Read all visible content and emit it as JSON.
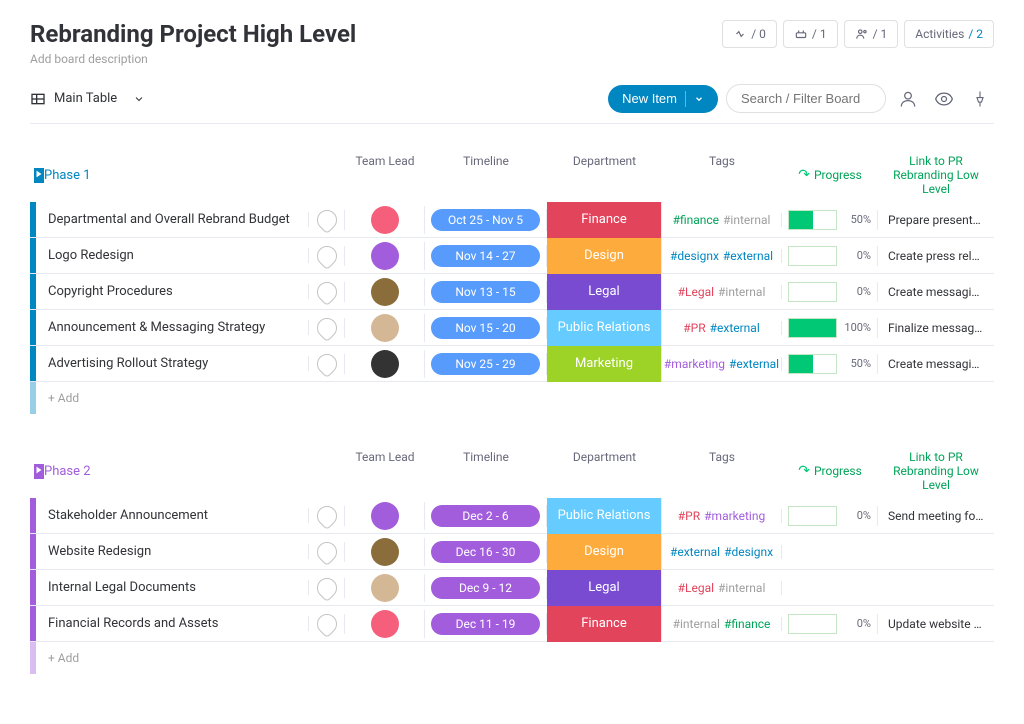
{
  "header": {
    "title": "Rebranding Project High Level",
    "description": "Add board description",
    "badge_sync": "/ 0",
    "badge_integ": "/ 1",
    "badge_people": "/ 1",
    "badge_activities_label": "Activities",
    "badge_activities_count": "/ 2"
  },
  "toolbar": {
    "view_label": "Main Table",
    "new_item_label": "New Item",
    "search_placeholder": "Search / Filter Board"
  },
  "columns": {
    "team_lead": "Team Lead",
    "timeline": "Timeline",
    "department": "Department",
    "tags": "Tags",
    "progress": "Progress",
    "link": "Link to PR Rebranding Low Level"
  },
  "add_label": "+ Add",
  "groups": [
    {
      "name": "Phase 1",
      "color": "#0086c0",
      "rows": [
        {
          "name": "Departmental and Overall Rebrand Budget",
          "avatar_color": "#f65f7c",
          "timeline": "Oct 25 - Nov 5",
          "timeline_bg": "#579bfc",
          "department": "Finance",
          "dept_bg": "#e2445c",
          "tags": [
            {
              "t": "#finance",
              "c": "#00a359"
            },
            {
              "t": "#internal",
              "c": "#9e9e9e"
            }
          ],
          "progress": 50,
          "link": "Prepare presentation for board memb..."
        },
        {
          "name": "Logo Redesign",
          "avatar_color": "#a25ddc",
          "timeline": "Nov 14 - 27",
          "timeline_bg": "#579bfc",
          "department": "Design",
          "dept_bg": "#fdab3d",
          "tags": [
            {
              "t": "#designx",
              "c": "#0086c0"
            },
            {
              "t": "#external",
              "c": "#0086c0"
            }
          ],
          "progress": 0,
          "link": "Create press release"
        },
        {
          "name": "Copyright Procedures",
          "avatar_color": "#8a6d3b",
          "timeline": "Nov 13 - 15",
          "timeline_bg": "#579bfc",
          "department": "Legal",
          "dept_bg": "#784bd1",
          "tags": [
            {
              "t": "#Legal",
              "c": "#e2445c"
            },
            {
              "t": "#internal",
              "c": "#9e9e9e"
            }
          ],
          "progress": 0,
          "link": "Create messaging copy for social plat..."
        },
        {
          "name": "Announcement & Messaging Strategy",
          "avatar_color": "#d4b896",
          "timeline": "Nov 15 - 20",
          "timeline_bg": "#579bfc",
          "department": "Public Relations",
          "dept_bg": "#66ccff",
          "tags": [
            {
              "t": "#PR",
              "c": "#e2445c"
            },
            {
              "t": "#external",
              "c": "#0086c0"
            }
          ],
          "progress": 100,
          "link": "Finalize message rollout strategy"
        },
        {
          "name": "Advertising Rollout Strategy",
          "avatar_color": "#333333",
          "timeline": "Nov 25 - 29",
          "timeline_bg": "#579bfc",
          "department": "Marketing",
          "dept_bg": "#9cd326",
          "tags": [
            {
              "t": "#marketing",
              "c": "#a25ddc"
            },
            {
              "t": "#external",
              "c": "#0086c0"
            }
          ],
          "progress": 50,
          "link": "Create messaging copy for website la..."
        }
      ]
    },
    {
      "name": "Phase 2",
      "color": "#a25ddc",
      "rows": [
        {
          "name": "Stakeholder Announcement",
          "avatar_color": "#a25ddc",
          "timeline": "Dec 2 - 6",
          "timeline_bg": "#a25ddc",
          "department": "Public Relations",
          "dept_bg": "#66ccff",
          "tags": [
            {
              "t": "#PR",
              "c": "#e2445c"
            },
            {
              "t": "#marketing",
              "c": "#a25ddc"
            }
          ],
          "progress": 0,
          "link": "Send meeting follow up and documen..."
        },
        {
          "name": "Website Redesign",
          "avatar_color": "#8a6d3b",
          "timeline": "Dec 16 - 30",
          "timeline_bg": "#a25ddc",
          "department": "Design",
          "dept_bg": "#fdab3d",
          "tags": [
            {
              "t": "#external",
              "c": "#0086c0"
            },
            {
              "t": "#designx",
              "c": "#0086c0"
            }
          ],
          "progress": null,
          "link": ""
        },
        {
          "name": "Internal Legal Documents",
          "avatar_color": "#d4b896",
          "timeline": "Dec 9 - 12",
          "timeline_bg": "#a25ddc",
          "department": "Legal",
          "dept_bg": "#784bd1",
          "tags": [
            {
              "t": "#Legal",
              "c": "#e2445c"
            },
            {
              "t": "#internal",
              "c": "#9e9e9e"
            }
          ],
          "progress": null,
          "link": ""
        },
        {
          "name": "Financial Records and Assets",
          "avatar_color": "#f65f7c",
          "timeline": "Dec 11 - 19",
          "timeline_bg": "#a25ddc",
          "department": "Finance",
          "dept_bg": "#e2445c",
          "tags": [
            {
              "t": "#internal",
              "c": "#9e9e9e"
            },
            {
              "t": "#finance",
              "c": "#00a359"
            }
          ],
          "progress": 0,
          "link": "Update website landing page"
        }
      ]
    }
  ]
}
